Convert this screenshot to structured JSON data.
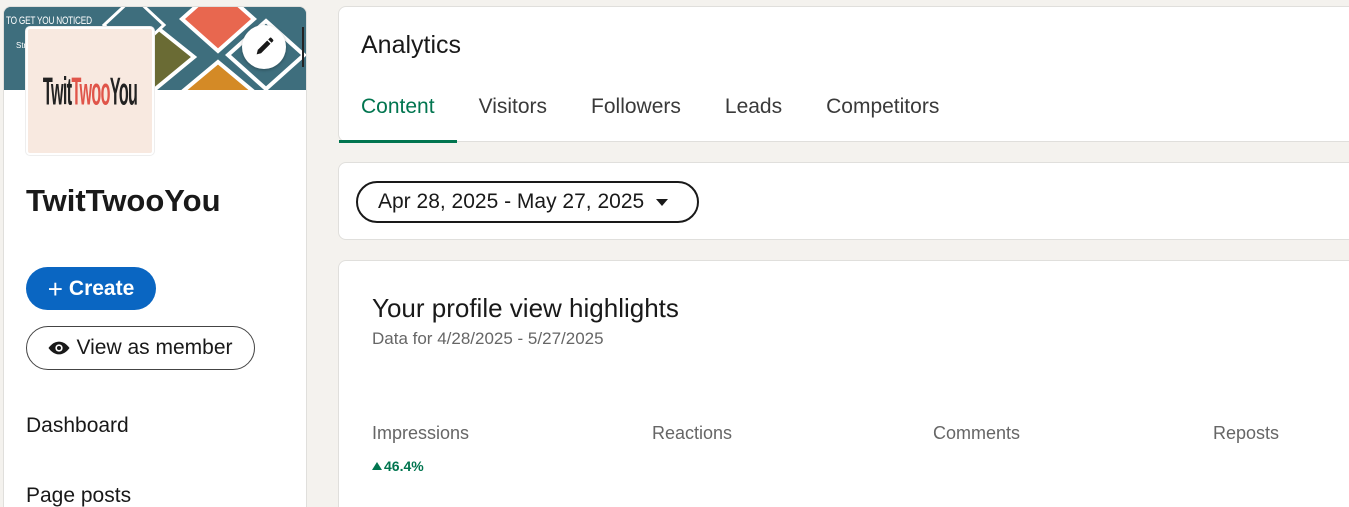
{
  "sidebar": {
    "banner_text": "TO GET YOU NOTICED",
    "banner_sub": "Str",
    "logo": {
      "part1": "Twit",
      "part2": "Twoo",
      "part3": "You"
    },
    "company_name": "TwitTwooYou",
    "create_label": "Create",
    "view_member_label": "View as member",
    "nav": [
      {
        "label": "Dashboard"
      },
      {
        "label": "Page posts"
      }
    ]
  },
  "analytics": {
    "title": "Analytics",
    "tabs": [
      {
        "label": "Content",
        "active": true
      },
      {
        "label": "Visitors"
      },
      {
        "label": "Followers"
      },
      {
        "label": "Leads"
      },
      {
        "label": "Competitors"
      }
    ]
  },
  "date_range": {
    "label": "Apr 28, 2025 - May 27, 2025"
  },
  "highlights": {
    "title": "Your profile view highlights",
    "subtitle": "Data for 4/28/2025 - 5/27/2025",
    "metrics": [
      {
        "label": "Impressions",
        "delta": "46.4%"
      },
      {
        "label": "Reactions"
      },
      {
        "label": "Comments"
      },
      {
        "label": "Reposts"
      }
    ]
  },
  "colors": {
    "primary_blue": "#0a66c2",
    "active_green": "#01754f",
    "banner_teal": "#3e6e7d"
  },
  "icons": {
    "edit": "pencil-icon",
    "create": "plus-icon",
    "view": "eye-icon",
    "dropdown": "caret-down-icon",
    "delta": "triangle-up-icon"
  }
}
